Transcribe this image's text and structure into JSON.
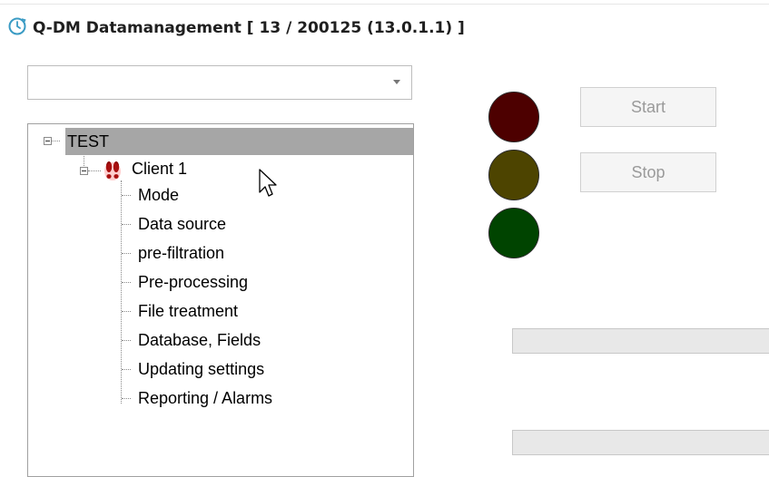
{
  "window": {
    "title": "Q-DM Datamanagement [ 13 / 200125 (13.0.1.1) ]",
    "icon": "clock-refresh-icon"
  },
  "client_select": {
    "value": "",
    "placeholder": ""
  },
  "tree": {
    "root": {
      "label": "TEST",
      "expanded": true,
      "selected": true
    },
    "client": {
      "label": "Client 1",
      "expanded": true,
      "status_icon": "alert-feet-icon"
    },
    "children": [
      "Mode",
      "Data source",
      "pre-filtration",
      "Pre-processing",
      "File treatment",
      "Database, Fields",
      "Updating settings",
      "Reporting / Alarms"
    ]
  },
  "traffic_light": {
    "red": "#4d0000",
    "yellow": "#4d4400",
    "green": "#004400"
  },
  "buttons": {
    "start": "Start",
    "stop": "Stop"
  },
  "progress": {
    "bar1": 0,
    "bar2": 0
  }
}
